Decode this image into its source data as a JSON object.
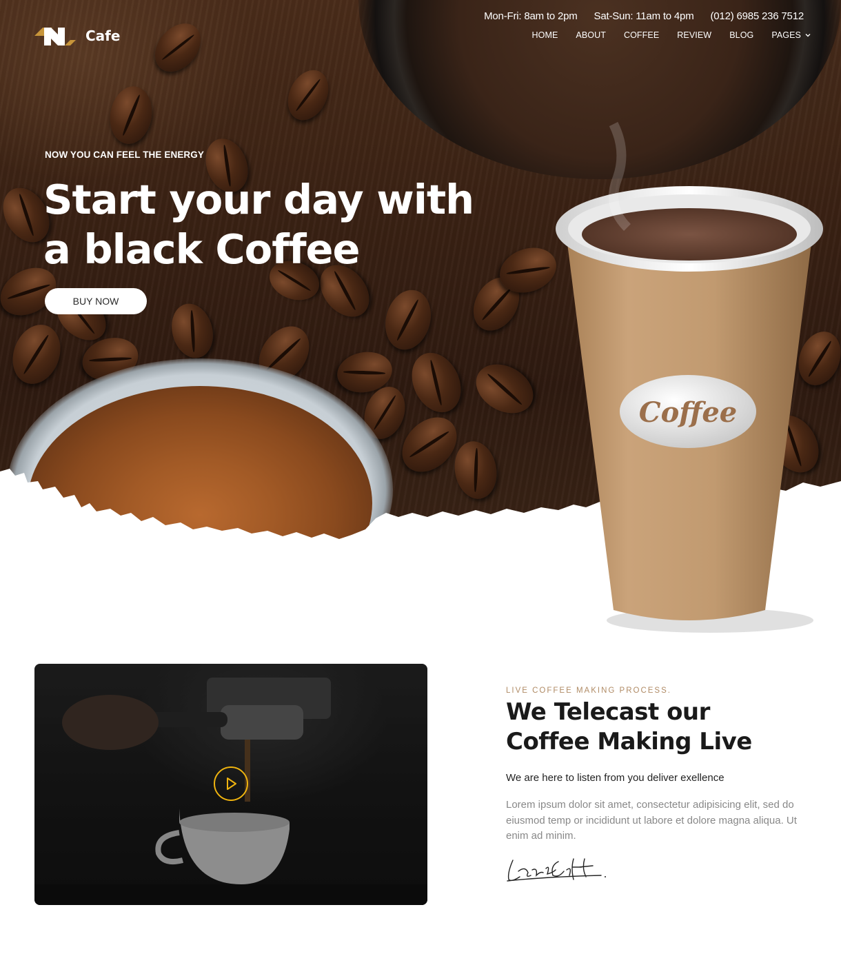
{
  "brand": {
    "name": "Cafe"
  },
  "topbar": {
    "weekday_hours": "Mon-Fri: 8am to 2pm",
    "weekend_hours": "Sat-Sun: 11am to 4pm",
    "phone": "(012) 6985 236 7512"
  },
  "nav": {
    "items": [
      "HOME",
      "ABOUT",
      "COFFEE",
      "REVIEW",
      "BLOG",
      "PAGES"
    ]
  },
  "hero": {
    "eyebrow": "NOW YOU CAN FEEL THE ENERGY",
    "title_line1": "Start your day with",
    "title_line2": "a black Coffee",
    "cta": "BUY NOW",
    "cup_label": "Coffee"
  },
  "live": {
    "label": "LIVE COFFEE MAKING PROCESS.",
    "title_line1": "We Telecast our",
    "title_line2": "Coffee Making Live",
    "tagline": "We are here to listen from you deliver exellence",
    "description": "Lorem ipsum dolor sit amet, consectetur adipisicing elit, sed do eiusmod temp or incididunt ut labore et dolore magna aliqua. Ut enim ad minim.",
    "signature": "LaraCroft"
  },
  "colors": {
    "accent": "#f0b40f",
    "label": "#b08b65",
    "hero_bg": "#3b2214",
    "cup": "#c79f72"
  },
  "icons": [
    "logo-icon",
    "chevron-down-icon",
    "play-icon"
  ]
}
